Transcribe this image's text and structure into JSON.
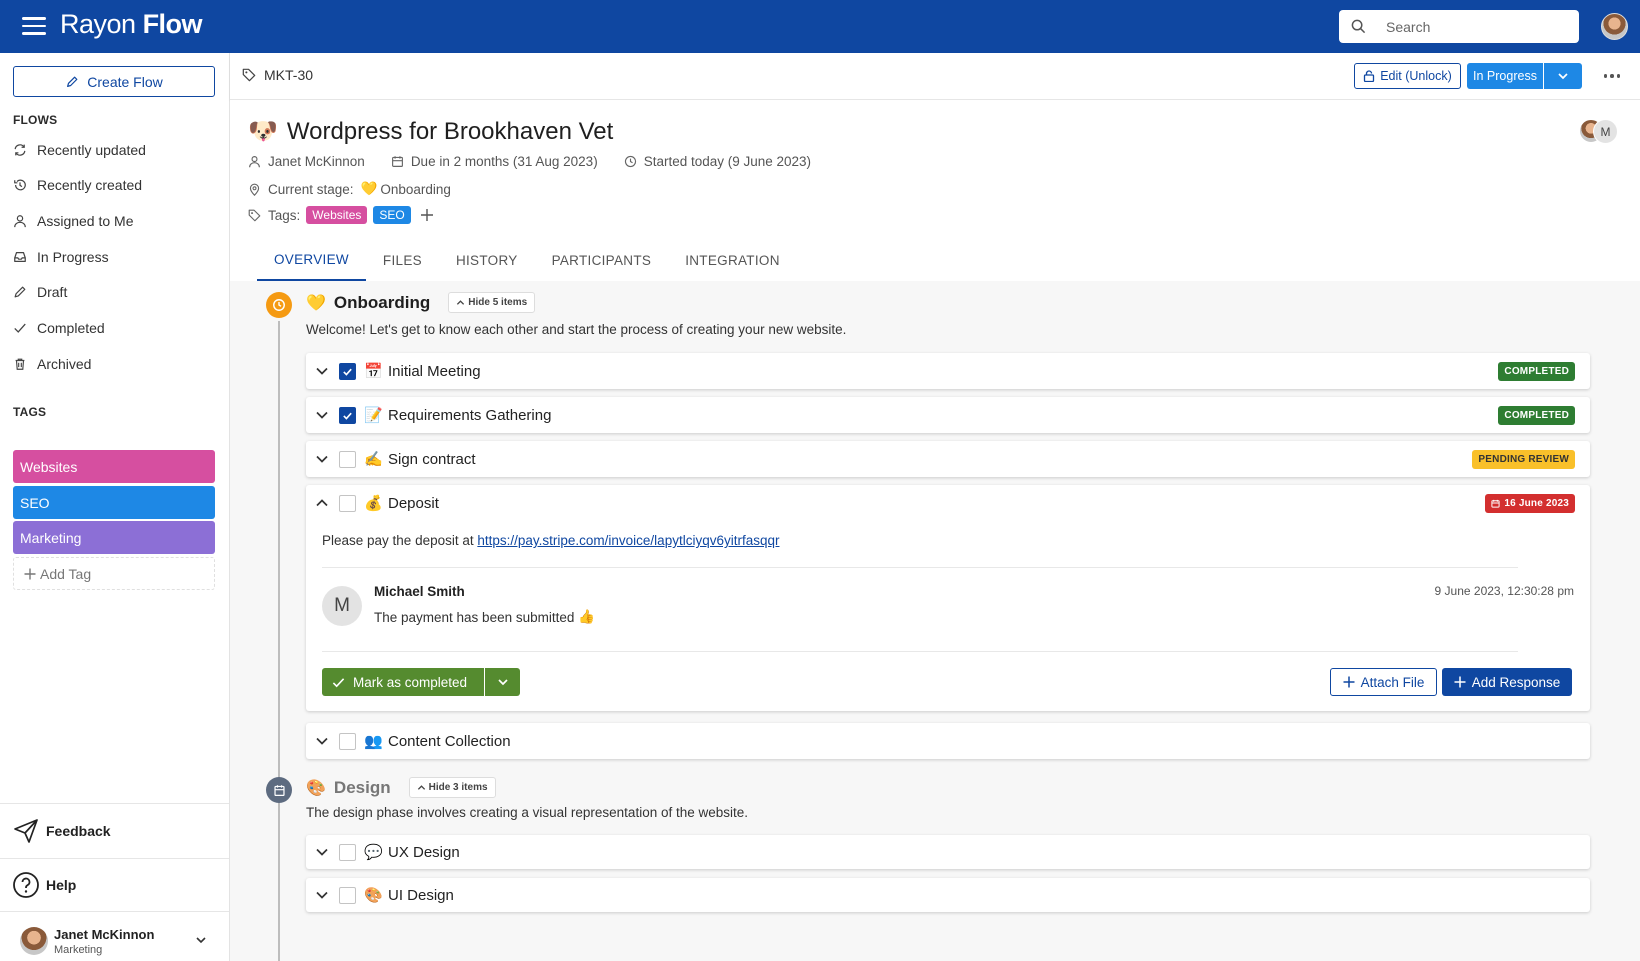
{
  "app": {
    "brand_light": "Rayon ",
    "brand_bold": "Flow",
    "search_placeholder": "Search"
  },
  "sidebar": {
    "create_label": "Create Flow",
    "flows_heading": "FLOWS",
    "flows": [
      {
        "label": "Recently updated",
        "icon": "refresh-icon"
      },
      {
        "label": "Recently created",
        "icon": "history-icon"
      },
      {
        "label": "Assigned to Me",
        "icon": "user-icon"
      },
      {
        "label": "In Progress",
        "icon": "inbox-icon"
      },
      {
        "label": "Draft",
        "icon": "pencil-icon"
      },
      {
        "label": "Completed",
        "icon": "check-icon"
      },
      {
        "label": "Archived",
        "icon": "trash-icon"
      }
    ],
    "tags_heading": "TAGS",
    "tags": [
      {
        "label": "Websites",
        "color": "#d64fa0"
      },
      {
        "label": "SEO",
        "color": "#1e88e5"
      },
      {
        "label": "Marketing",
        "color": "#8c6fd6"
      }
    ],
    "add_tag_label": "Add Tag",
    "feedback_label": "Feedback",
    "help_label": "Help",
    "user": {
      "name": "Janet McKinnon",
      "role": "Marketing"
    }
  },
  "header": {
    "ticket_id": "MKT-30",
    "edit_label": "Edit (Unlock)",
    "status_label": "In Progress"
  },
  "flow": {
    "emoji": "🐶",
    "title": "Wordpress for Brookhaven Vet",
    "owner": "Janet McKinnon",
    "due": "Due in 2 months (31 Aug 2023)",
    "started": "Started today (9 June 2023)",
    "stage_label": "Current stage:",
    "stage_emoji": "💛",
    "stage_value": "Onboarding",
    "tags_label": "Tags:",
    "tags": [
      {
        "label": "Websites",
        "color": "#d64fa0"
      },
      {
        "label": "SEO",
        "color": "#1e88e5"
      }
    ],
    "participant_initial": "M"
  },
  "tabs": [
    "OVERVIEW",
    "FILES",
    "HISTORY",
    "PARTICIPANTS",
    "INTEGRATION"
  ],
  "stages": [
    {
      "emoji": "💛",
      "title": "Onboarding",
      "hide_label": "Hide 5 items",
      "description": "Welcome! Let's get to know each other and start the process of creating your new website.",
      "color": "#f59a12",
      "tasks": [
        {
          "emoji": "📅",
          "title": "Initial Meeting",
          "checked": true,
          "badge": "COMPLETED"
        },
        {
          "emoji": "📝",
          "title": "Requirements Gathering",
          "checked": true,
          "badge": "COMPLETED"
        },
        {
          "emoji": "✍️",
          "title": "Sign contract",
          "checked": false,
          "badge": "PENDING REVIEW"
        },
        {
          "emoji": "💰",
          "title": "Deposit",
          "checked": false,
          "badge": "16 June 2023"
        },
        {
          "emoji": "👥",
          "title": "Content Collection",
          "checked": false
        }
      ]
    },
    {
      "emoji": "🎨",
      "title": "Design",
      "hide_label": "Hide 3 items",
      "description": "The design phase involves creating a visual representation of the website.",
      "color": "#5d6b80",
      "tasks": [
        {
          "emoji": "💬",
          "title": "UX Design",
          "checked": false
        },
        {
          "emoji": "🎨",
          "title": "UI Design",
          "checked": false
        }
      ]
    }
  ],
  "deposit": {
    "text": "Please pay the deposit at ",
    "link": "https://pay.stripe.com/invoice/lapytlciyqv6yitrfasqqr",
    "response": {
      "initial": "M",
      "name": "Michael Smith",
      "text": "The payment has been submitted",
      "emoji": "👍",
      "time": "9 June 2023, 12:30:28 pm"
    },
    "mark_label": "Mark as completed",
    "attach_label": "Attach File",
    "add_response_label": "Add Response"
  }
}
